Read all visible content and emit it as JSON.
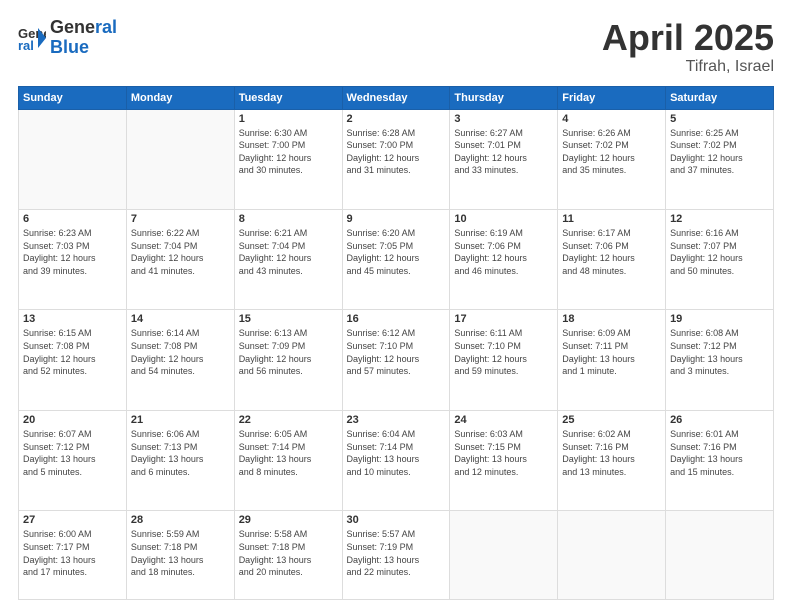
{
  "header": {
    "logo_line1": "General",
    "logo_line2": "Blue",
    "month": "April 2025",
    "location": "Tifrah, Israel"
  },
  "weekdays": [
    "Sunday",
    "Monday",
    "Tuesday",
    "Wednesday",
    "Thursday",
    "Friday",
    "Saturday"
  ],
  "days": [
    {
      "num": "",
      "info": ""
    },
    {
      "num": "",
      "info": ""
    },
    {
      "num": "1",
      "info": "Sunrise: 6:30 AM\nSunset: 7:00 PM\nDaylight: 12 hours\nand 30 minutes."
    },
    {
      "num": "2",
      "info": "Sunrise: 6:28 AM\nSunset: 7:00 PM\nDaylight: 12 hours\nand 31 minutes."
    },
    {
      "num": "3",
      "info": "Sunrise: 6:27 AM\nSunset: 7:01 PM\nDaylight: 12 hours\nand 33 minutes."
    },
    {
      "num": "4",
      "info": "Sunrise: 6:26 AM\nSunset: 7:02 PM\nDaylight: 12 hours\nand 35 minutes."
    },
    {
      "num": "5",
      "info": "Sunrise: 6:25 AM\nSunset: 7:02 PM\nDaylight: 12 hours\nand 37 minutes."
    },
    {
      "num": "6",
      "info": "Sunrise: 6:23 AM\nSunset: 7:03 PM\nDaylight: 12 hours\nand 39 minutes."
    },
    {
      "num": "7",
      "info": "Sunrise: 6:22 AM\nSunset: 7:04 PM\nDaylight: 12 hours\nand 41 minutes."
    },
    {
      "num": "8",
      "info": "Sunrise: 6:21 AM\nSunset: 7:04 PM\nDaylight: 12 hours\nand 43 minutes."
    },
    {
      "num": "9",
      "info": "Sunrise: 6:20 AM\nSunset: 7:05 PM\nDaylight: 12 hours\nand 45 minutes."
    },
    {
      "num": "10",
      "info": "Sunrise: 6:19 AM\nSunset: 7:06 PM\nDaylight: 12 hours\nand 46 minutes."
    },
    {
      "num": "11",
      "info": "Sunrise: 6:17 AM\nSunset: 7:06 PM\nDaylight: 12 hours\nand 48 minutes."
    },
    {
      "num": "12",
      "info": "Sunrise: 6:16 AM\nSunset: 7:07 PM\nDaylight: 12 hours\nand 50 minutes."
    },
    {
      "num": "13",
      "info": "Sunrise: 6:15 AM\nSunset: 7:08 PM\nDaylight: 12 hours\nand 52 minutes."
    },
    {
      "num": "14",
      "info": "Sunrise: 6:14 AM\nSunset: 7:08 PM\nDaylight: 12 hours\nand 54 minutes."
    },
    {
      "num": "15",
      "info": "Sunrise: 6:13 AM\nSunset: 7:09 PM\nDaylight: 12 hours\nand 56 minutes."
    },
    {
      "num": "16",
      "info": "Sunrise: 6:12 AM\nSunset: 7:10 PM\nDaylight: 12 hours\nand 57 minutes."
    },
    {
      "num": "17",
      "info": "Sunrise: 6:11 AM\nSunset: 7:10 PM\nDaylight: 12 hours\nand 59 minutes."
    },
    {
      "num": "18",
      "info": "Sunrise: 6:09 AM\nSunset: 7:11 PM\nDaylight: 13 hours\nand 1 minute."
    },
    {
      "num": "19",
      "info": "Sunrise: 6:08 AM\nSunset: 7:12 PM\nDaylight: 13 hours\nand 3 minutes."
    },
    {
      "num": "20",
      "info": "Sunrise: 6:07 AM\nSunset: 7:12 PM\nDaylight: 13 hours\nand 5 minutes."
    },
    {
      "num": "21",
      "info": "Sunrise: 6:06 AM\nSunset: 7:13 PM\nDaylight: 13 hours\nand 6 minutes."
    },
    {
      "num": "22",
      "info": "Sunrise: 6:05 AM\nSunset: 7:14 PM\nDaylight: 13 hours\nand 8 minutes."
    },
    {
      "num": "23",
      "info": "Sunrise: 6:04 AM\nSunset: 7:14 PM\nDaylight: 13 hours\nand 10 minutes."
    },
    {
      "num": "24",
      "info": "Sunrise: 6:03 AM\nSunset: 7:15 PM\nDaylight: 13 hours\nand 12 minutes."
    },
    {
      "num": "25",
      "info": "Sunrise: 6:02 AM\nSunset: 7:16 PM\nDaylight: 13 hours\nand 13 minutes."
    },
    {
      "num": "26",
      "info": "Sunrise: 6:01 AM\nSunset: 7:16 PM\nDaylight: 13 hours\nand 15 minutes."
    },
    {
      "num": "27",
      "info": "Sunrise: 6:00 AM\nSunset: 7:17 PM\nDaylight: 13 hours\nand 17 minutes."
    },
    {
      "num": "28",
      "info": "Sunrise: 5:59 AM\nSunset: 7:18 PM\nDaylight: 13 hours\nand 18 minutes."
    },
    {
      "num": "29",
      "info": "Sunrise: 5:58 AM\nSunset: 7:18 PM\nDaylight: 13 hours\nand 20 minutes."
    },
    {
      "num": "30",
      "info": "Sunrise: 5:57 AM\nSunset: 7:19 PM\nDaylight: 13 hours\nand 22 minutes."
    },
    {
      "num": "",
      "info": ""
    },
    {
      "num": "",
      "info": ""
    },
    {
      "num": "",
      "info": ""
    }
  ]
}
